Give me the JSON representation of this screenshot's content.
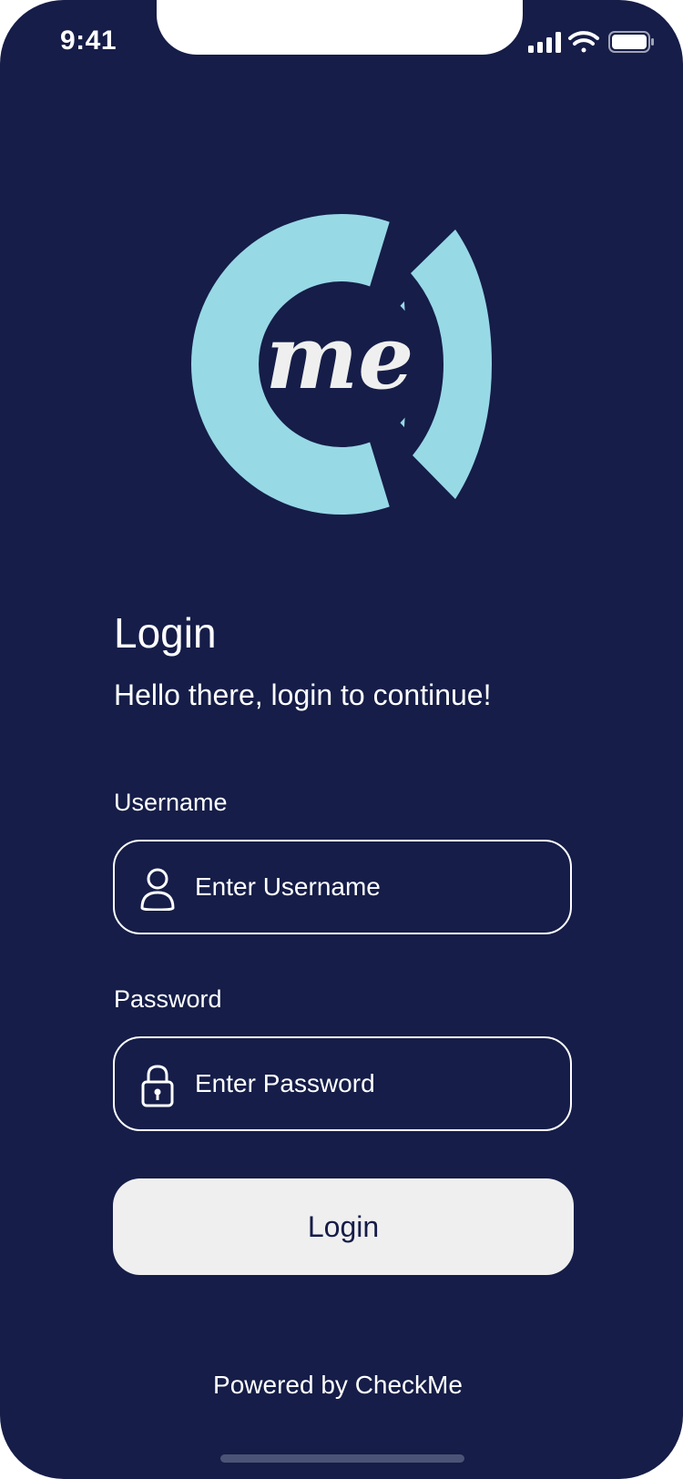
{
  "colors": {
    "background": "#151d48",
    "accent": "#98d9e6",
    "button_bg": "#efefef",
    "text": "#ffffff"
  },
  "status_bar": {
    "time": "9:41",
    "icons": [
      "signal-icon",
      "wifi-icon",
      "battery-icon"
    ]
  },
  "logo": {
    "text": "me",
    "icon": "checkme-logo"
  },
  "login": {
    "title": "Login",
    "subtitle": "Hello there, login to continue!"
  },
  "username": {
    "label": "Username",
    "placeholder": "Enter Username",
    "value": "",
    "icon": "user-icon"
  },
  "password": {
    "label": "Password",
    "placeholder": "Enter Password",
    "value": "",
    "icon": "lock-icon"
  },
  "login_button": {
    "label": "Login"
  },
  "footer": {
    "text": "Powered by CheckMe"
  }
}
